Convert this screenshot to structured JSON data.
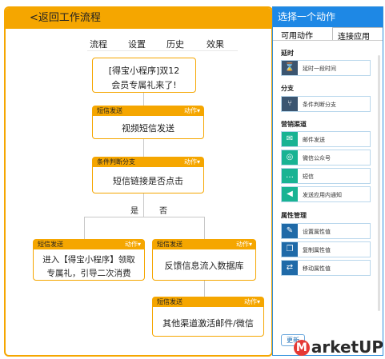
{
  "canvas": {
    "back_label": "<返回工作流程",
    "tabs": [
      "流程",
      "设置",
      "历史",
      "效果"
    ],
    "start_node": {
      "line1": "[得宝小程序]双12",
      "line2": "会员专属礼来了!"
    },
    "nodes": [
      {
        "type": "短信发送",
        "action": "动作▾",
        "body": "视频短信发送"
      },
      {
        "type": "条件判断分支",
        "action": "动作▾",
        "body": "短信链接是否点击"
      },
      {
        "type": "短信发送",
        "action": "动作▾",
        "line1": "进入【得宝小程序】领取",
        "line2": "专属礼，引导二次消费"
      },
      {
        "type": "短信发送",
        "action": "动作▾",
        "body": "反馈信息流入数据库"
      },
      {
        "type": "短信发送",
        "action": "动作▾",
        "body": "其他渠道激活邮件/微信"
      }
    ],
    "branch_yes": "是",
    "branch_no": "否"
  },
  "panel": {
    "title": "选择一个动作",
    "tab_available": "可用动作",
    "tab_connected": "连接应用",
    "sections": [
      {
        "title": "延时",
        "items": [
          {
            "label": "延时一段时间",
            "icon": "hourglass-icon"
          }
        ]
      },
      {
        "title": "分支",
        "items": [
          {
            "label": "条件判断分支",
            "icon": "branch-icon"
          }
        ]
      },
      {
        "title": "营销渠道",
        "items": [
          {
            "label": "邮件发送",
            "icon": "mail-icon"
          },
          {
            "label": "微信公众号",
            "icon": "wechat-icon"
          },
          {
            "label": "短信",
            "icon": "sms-icon"
          },
          {
            "label": "发送应用内通知",
            "icon": "megaphone-icon"
          }
        ]
      },
      {
        "title": "属性管理",
        "items": [
          {
            "label": "设置属性值",
            "icon": "edit-icon"
          },
          {
            "label": "复制属性值",
            "icon": "copy-icon"
          },
          {
            "label": "移动属性值",
            "icon": "move-icon"
          }
        ]
      }
    ],
    "save_label": "更新"
  },
  "watermark": "arketUP",
  "colors": {
    "accent_orange": "#f5a600",
    "panel_blue": "#1e88e5",
    "icon_teal": "#19b393"
  }
}
